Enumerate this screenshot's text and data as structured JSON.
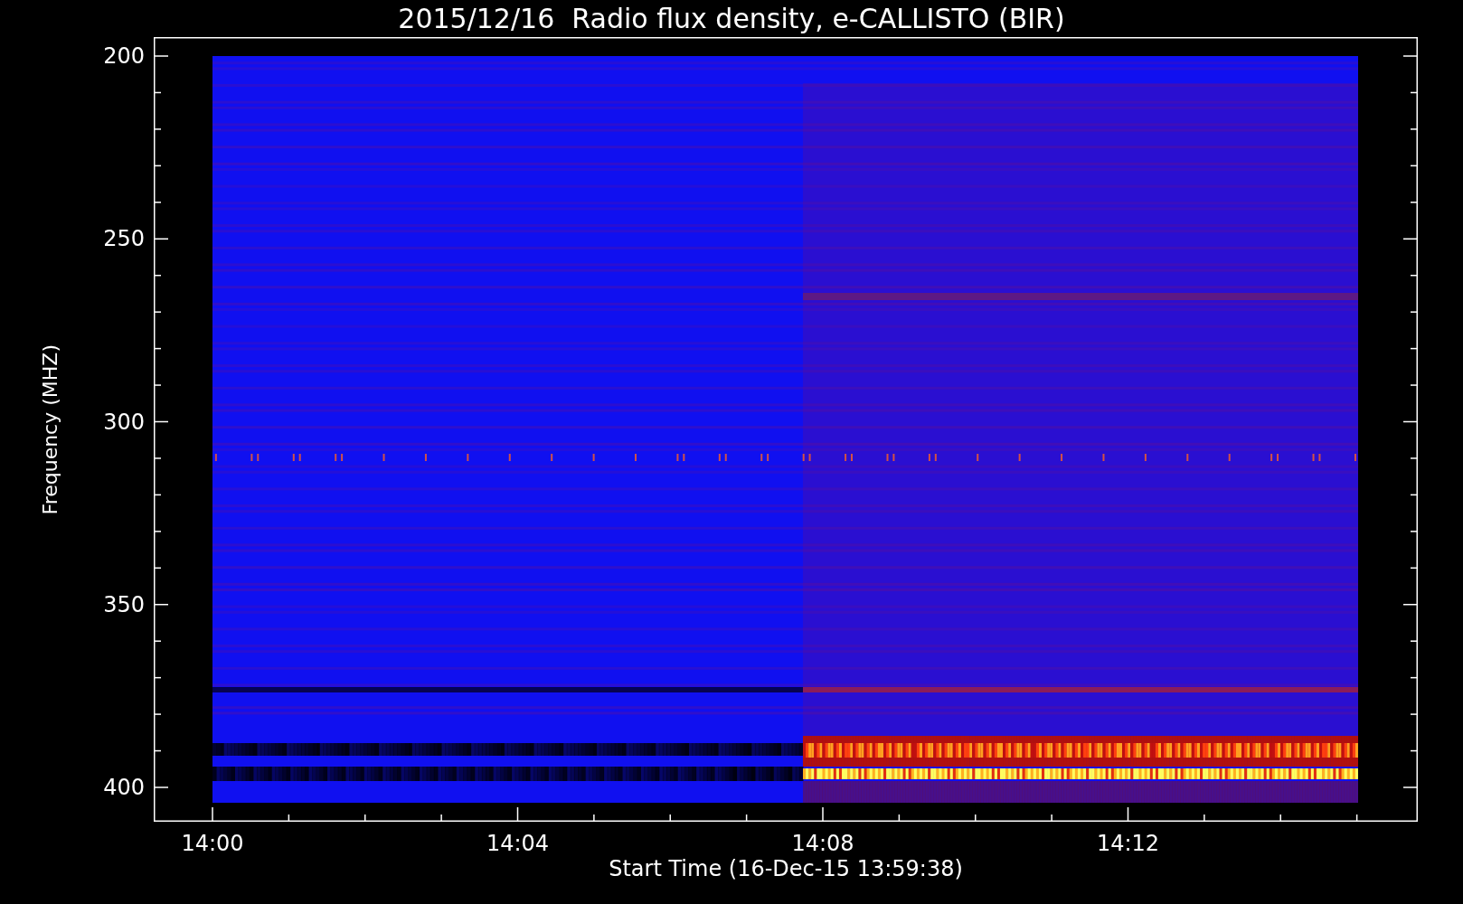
{
  "title": "2015/12/16  Radio flux density, e-CALLISTO (BIR)",
  "y_axis": {
    "label": "Frequency (MHZ)",
    "ticks": [
      "200",
      "250",
      "300",
      "350",
      "400"
    ]
  },
  "x_axis": {
    "label": "Start Time (16-Dec-15 13:59:38)",
    "ticks": [
      "14:00",
      "14:04",
      "14:08",
      "14:12"
    ]
  }
}
